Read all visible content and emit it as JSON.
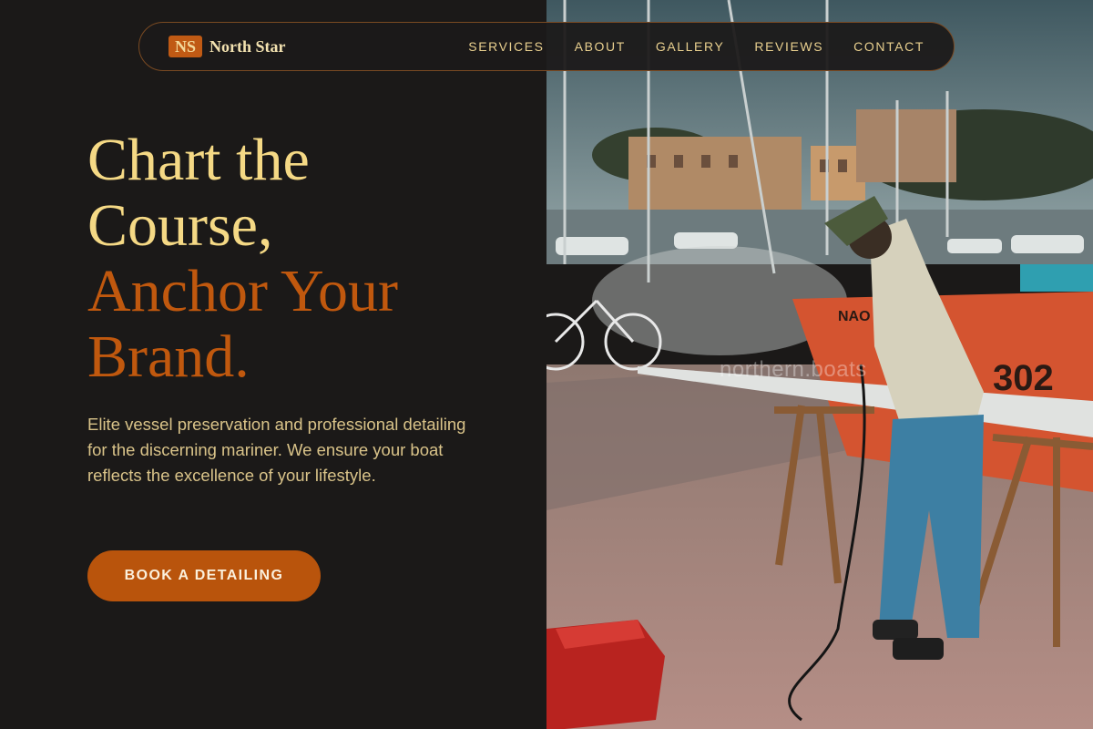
{
  "brand": {
    "badge": "NS",
    "name": "North Star"
  },
  "nav": {
    "links": [
      {
        "label": "SERVICES"
      },
      {
        "label": "ABOUT"
      },
      {
        "label": "GALLERY"
      },
      {
        "label": "REVIEWS"
      },
      {
        "label": "CONTACT"
      }
    ]
  },
  "hero": {
    "title_line1": "Chart the",
    "title_line2": "Course,",
    "title_line3": "Anchor Your",
    "title_line4": "Brand.",
    "description": "Elite vessel preservation and professional detailing for the discerning mariner. We ensure your boat reflects the excellence of your lifestyle.",
    "cta_label": "BOOK A DETAILING"
  },
  "photo": {
    "watermark": "northern.boats",
    "container_text": "NAO",
    "container_number": "302"
  },
  "colors": {
    "background": "#1b1918",
    "accent": "#c0580e",
    "headline": "#f5d985",
    "body_text": "#d9c389"
  }
}
